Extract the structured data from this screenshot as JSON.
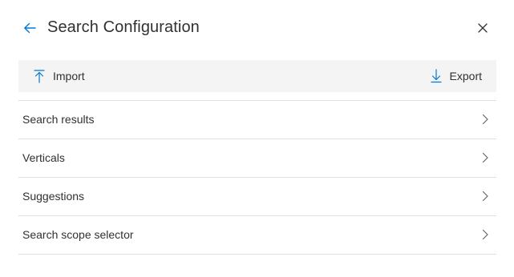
{
  "header": {
    "title": "Search Configuration",
    "back_icon": "arrow-left-icon",
    "close_icon": "close-icon"
  },
  "toolbar": {
    "import_label": "Import",
    "import_icon": "upload-arrow-icon",
    "export_label": "Export",
    "export_icon": "download-arrow-icon"
  },
  "items": [
    {
      "label": "Search results",
      "icon": "chevron-right-icon"
    },
    {
      "label": "Verticals",
      "icon": "chevron-right-icon"
    },
    {
      "label": "Suggestions",
      "icon": "chevron-right-icon"
    },
    {
      "label": "Search scope selector",
      "icon": "chevron-right-icon"
    }
  ],
  "colors": {
    "accent": "#0078d4",
    "text": "#323130",
    "toolbar_bg": "#f4f4f4",
    "divider": "#e1dfdd"
  }
}
